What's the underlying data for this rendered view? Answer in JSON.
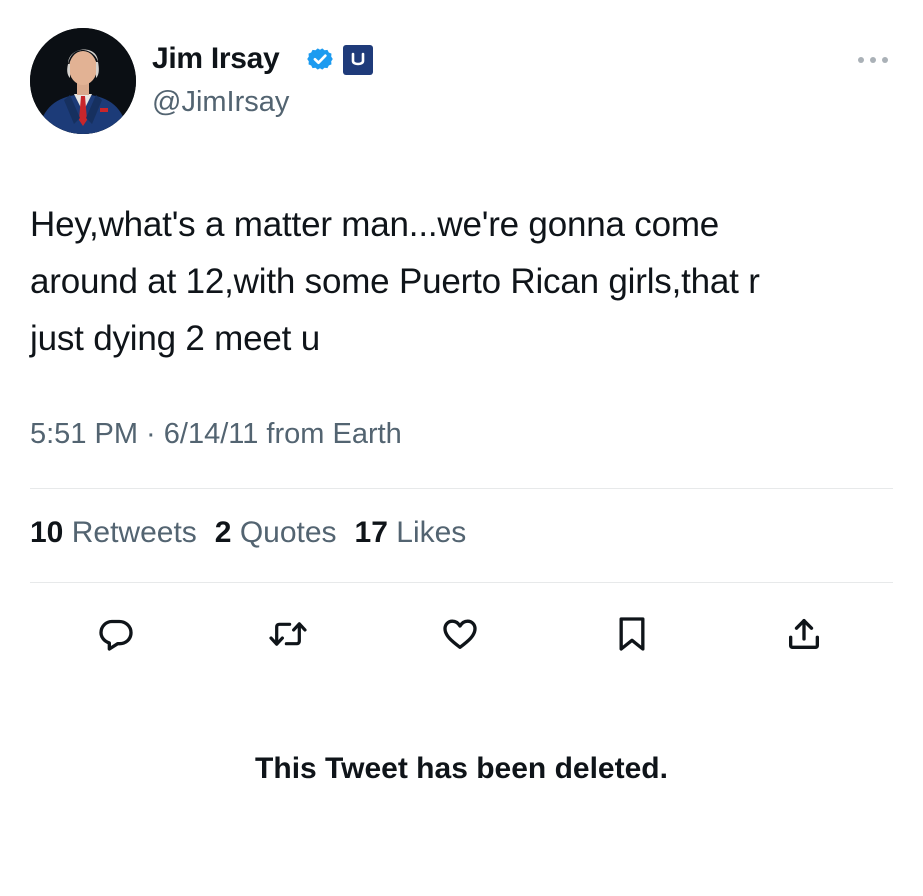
{
  "author": {
    "display_name": "Jim Irsay",
    "handle": "@JimIrsay",
    "verified": true
  },
  "tweet": {
    "text": "Hey,what's a matter man...we're gonna come\naround at 12,with some Puerto Rican girls,that r\njust dying 2 meet u",
    "timestamp": "5:51 PM · 6/14/11 from Earth"
  },
  "stats": {
    "retweets": {
      "count": "10",
      "label": "Retweets"
    },
    "quotes": {
      "count": "2",
      "label": "Quotes"
    },
    "likes": {
      "count": "17",
      "label": "Likes"
    }
  },
  "actions": [
    "reply-icon",
    "retweet-icon",
    "like-icon",
    "bookmark-icon",
    "share-icon"
  ],
  "notice": "This Tweet has been deleted.",
  "colors": {
    "verified": "#1d9bf0",
    "affiliate_badge": "#1f3b7a",
    "secondary_text": "#536471",
    "primary_text": "#0f1419",
    "divider": "#e7e9ea"
  }
}
